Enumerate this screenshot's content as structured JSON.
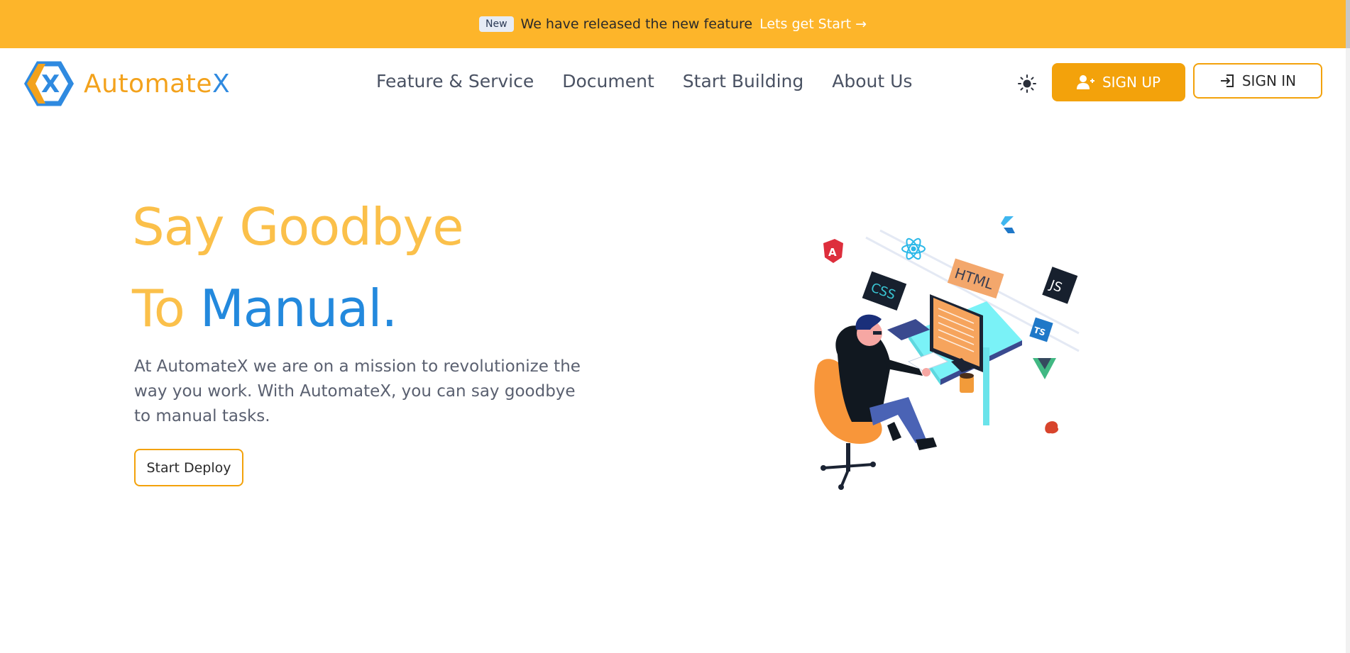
{
  "announcement": {
    "badge": "New",
    "message": "We have released the new feature",
    "cta": "Lets get Start",
    "cta_arrow": "→",
    "background": "#fdb52a"
  },
  "header": {
    "logo": {
      "part1": "Automate",
      "part2": "X"
    },
    "nav": [
      "Feature & Service",
      "Document",
      "Start Building",
      "About Us"
    ],
    "theme_icon": "sun-icon",
    "signup": {
      "label": "SIGN UP",
      "icon": "user-plus-icon"
    },
    "signin": {
      "label": "SIGN IN",
      "icon": "sign-in-icon"
    }
  },
  "hero": {
    "line1": "Say Goodbye",
    "line2_prefix": "To",
    "line2_highlight": "Manual.",
    "description": "At AutomateX we are on a mission to revolutionize the way you work. With AutomateX, you can say goodbye to manual tasks.",
    "cta": "Start Deploy",
    "illustration_tags": [
      "HTML",
      "CSS",
      "JS",
      "TS",
      "A"
    ]
  },
  "colors": {
    "accent": "#f3a20b",
    "blue": "#2389dd",
    "yellow": "#fbc04a"
  }
}
